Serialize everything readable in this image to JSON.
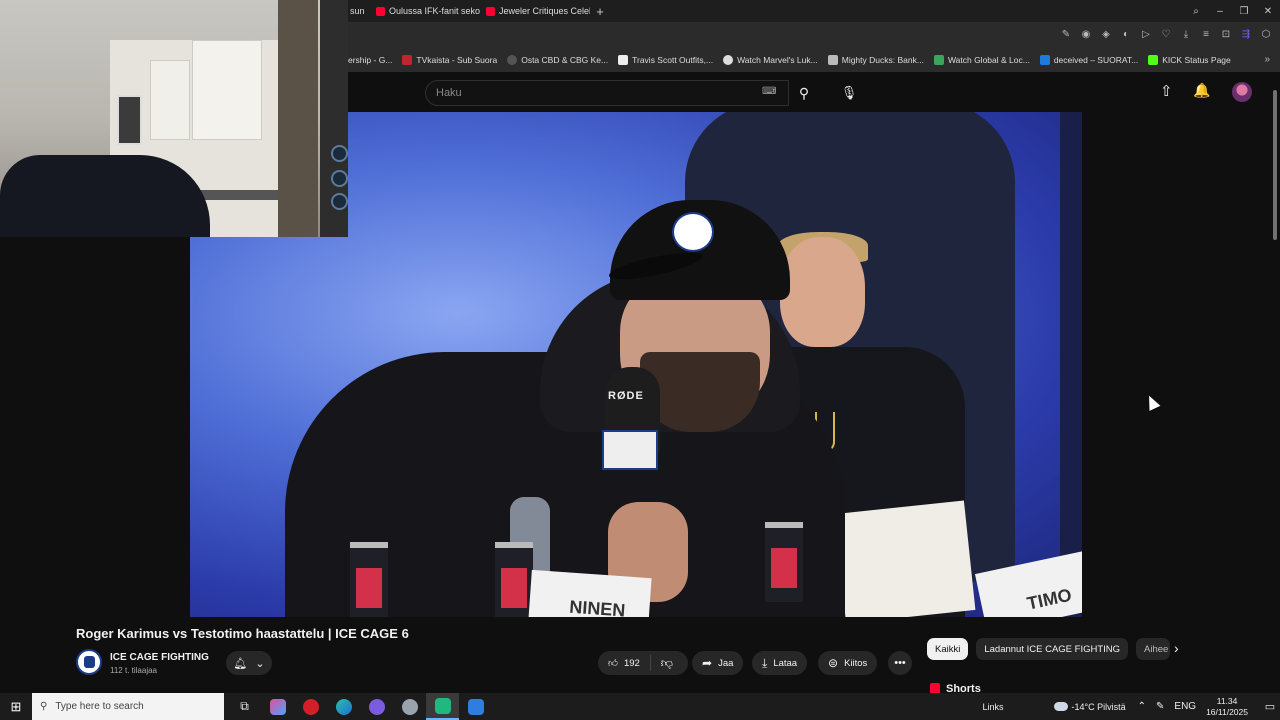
{
  "browser": {
    "tabs": [
      {
        "title": "sun"
      },
      {
        "title": "Oulussa IFK-fanit sekoilee"
      },
      {
        "title": "Jeweler Critiques Celebrity"
      }
    ],
    "new_tab": "+",
    "window_controls": [
      "–",
      "❐",
      "✕"
    ],
    "bookmarks": [
      "ership - G...",
      "TVkaista - Sub Suora",
      "Osta CBD & CBG Ke...",
      "Travis Scott Outfits,...",
      "Watch Marvel's Luk...",
      "Mighty Ducks: Bank...",
      "Watch Global & Loc...",
      "deceived – SUORAT...",
      "KICK Status Page"
    ],
    "bookmarks_more": "»"
  },
  "youtube": {
    "search": {
      "placeholder": "Haku"
    },
    "video": {
      "title": "Roger Karimus vs Testotimo haastattelu | ICE CAGE 6",
      "player_overlay": {
        "mic_brand": "RØDE",
        "card_left": "NINEN",
        "card_right": "TIMO"
      }
    },
    "channel": {
      "name": "ICE CAGE FIGHTING",
      "subscribers": "112 t. tilaajaa"
    },
    "actions": {
      "likes": "192",
      "share": "Jaa",
      "download": "Lataa",
      "thanks": "Kiitos",
      "more": "•••"
    },
    "chips": [
      {
        "label": "Kaikki",
        "active": true
      },
      {
        "label": "Ladannut ICE CAGE FIGHTING",
        "active": false
      },
      {
        "label": "Aihee",
        "active": false
      }
    ],
    "shorts_heading": "Shorts"
  },
  "taskbar": {
    "search_placeholder": "Type here to search",
    "links": "Links",
    "weather": "-14°C  Pilvistä",
    "language": "ENG",
    "time": "11.34",
    "date": "16/11/2025"
  }
}
